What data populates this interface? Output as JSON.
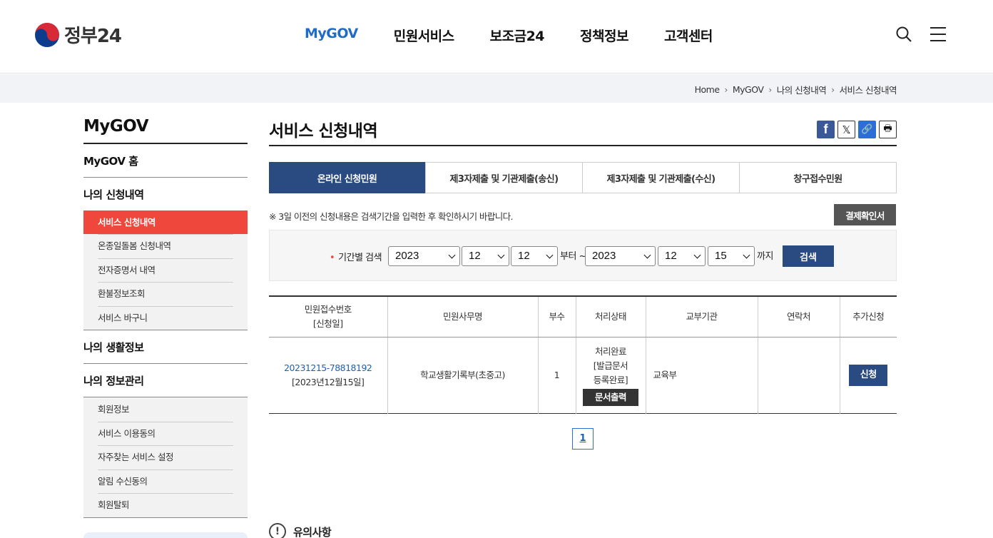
{
  "header": {
    "logo_text": "정부24",
    "nav": [
      "MyGOV",
      "민원서비스",
      "보조금24",
      "정책정보",
      "고객센터"
    ]
  },
  "breadcrumb": [
    "Home",
    "MyGOV",
    "나의 신청내역",
    "서비스 신청내역"
  ],
  "sidebar": {
    "title": "MyGOV",
    "home": "MyGOV 홈",
    "group1": {
      "label": "나의 신청내역",
      "items": [
        "서비스 신청내역",
        "온종일돌봄 신청내역",
        "전자증명서 내역",
        "환불정보조회",
        "서비스 바구니"
      ]
    },
    "group2": {
      "label": "나의 생활정보"
    },
    "group3": {
      "label": "나의 정보관리",
      "items": [
        "회원정보",
        "서비스 이용동의",
        "자주찾는 서비스 설정",
        "알림 수신동의",
        "회원탈퇴"
      ]
    }
  },
  "main": {
    "title": "서비스 신청내역",
    "tabs": [
      "온라인 신청민원",
      "제3자제출 및 기관제출(송신)",
      "제3자제출 및 기관제출(수신)",
      "창구접수민원"
    ],
    "notice": "※ 3일 이전의 신청내용은 검색기간을 입력한 후 확인하시기 바랍니다.",
    "pay_button": "결제확인서",
    "search": {
      "label": "기간별 검색",
      "from_year": "2023",
      "from_month": "12",
      "from_day": "12",
      "from_text": "부터 ~",
      "to_year": "2023",
      "to_month": "12",
      "to_day": "15",
      "to_text": "까지",
      "button": "검색"
    },
    "table": {
      "headers": {
        "receipt_no": "민원접수번호",
        "receipt_date": "[신청일]",
        "service": "민원사무명",
        "copies": "부수",
        "status": "처리상태",
        "agency": "교부기관",
        "contact": "연락처",
        "extra": "추가신청"
      },
      "rows": [
        {
          "receipt_no": "20231215-78818192",
          "date": "[2023년12월15일]",
          "service": "학교생활기록부(초중고)",
          "copies": "1",
          "status_1": "처리완료",
          "status_2": "[발급문서",
          "status_3": "등록완료]",
          "doc_button": "문서출력",
          "agency": "교육부",
          "contact": "",
          "apply_button": "신청"
        }
      ]
    },
    "pagination": {
      "current": "1"
    },
    "caution_title": "유의사항"
  }
}
